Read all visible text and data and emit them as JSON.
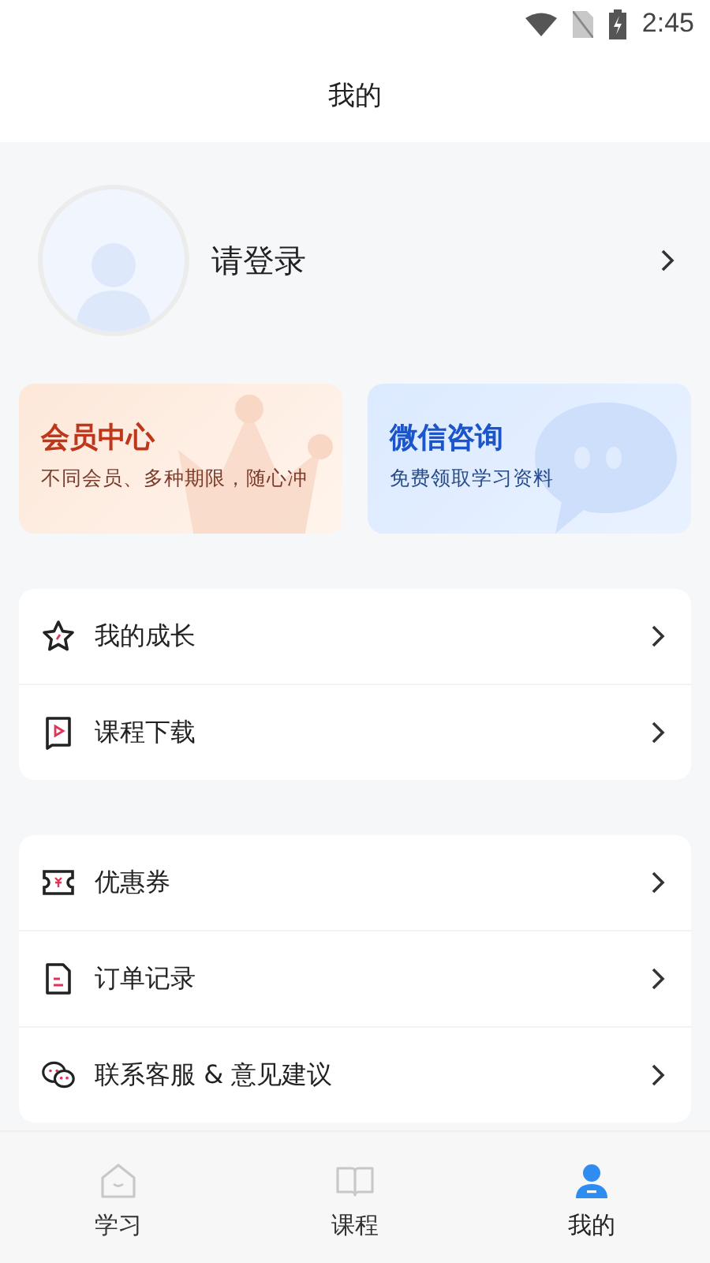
{
  "status_bar": {
    "time": "2:45"
  },
  "header": {
    "title": "我的"
  },
  "profile": {
    "login": "请登录"
  },
  "promo_cards": [
    {
      "kind": "member",
      "title": "会员中心",
      "subtitle": "不同会员、多种期限，随心冲"
    },
    {
      "kind": "wechat",
      "title": "微信咨询",
      "subtitle": "免费领取学习资料"
    }
  ],
  "menu_groups": [
    {
      "items": [
        {
          "kind": "star",
          "label": "我的成长"
        },
        {
          "kind": "video",
          "label": "课程下载"
        }
      ]
    },
    {
      "items": [
        {
          "kind": "coupon",
          "label": "优惠券"
        },
        {
          "kind": "order",
          "label": "订单记录"
        },
        {
          "kind": "chat",
          "label": "联系客服 & 意见建议"
        }
      ]
    }
  ],
  "tab_bar": [
    {
      "kind": "home",
      "label": "学习",
      "selected": false
    },
    {
      "kind": "book",
      "label": "课程",
      "selected": false
    },
    {
      "kind": "person",
      "label": "我的",
      "selected": true
    }
  ]
}
